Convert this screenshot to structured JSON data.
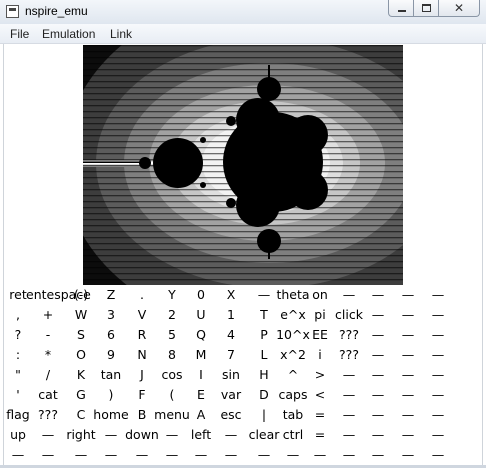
{
  "window": {
    "title": "nspire_emu",
    "close_label": "✕"
  },
  "menu": [
    "File",
    "Emulation",
    "Link"
  ],
  "keypad_rows": [
    [
      "ret",
      "entespace",
      "(-)",
      "Z",
      ".",
      "Y",
      "0",
      "X",
      "—",
      "theta",
      "on",
      "—",
      "—",
      "—",
      "—"
    ],
    [
      ",",
      "+",
      "W",
      "3",
      "V",
      "2",
      "U",
      "1",
      "T",
      "e^x",
      "pi",
      "click",
      "—",
      "—",
      "—"
    ],
    [
      "?",
      "-",
      "S",
      "6",
      "R",
      "5",
      "Q",
      "4",
      "P",
      "10^x",
      "EE",
      "???",
      "—",
      "—",
      "—"
    ],
    [
      ":",
      "*",
      "O",
      "9",
      "N",
      "8",
      "M",
      "7",
      "L",
      "x^2",
      "i",
      "???",
      "—",
      "—",
      "—"
    ],
    [
      "\"",
      "/",
      "K",
      "tan",
      "J",
      "cos",
      "I",
      "sin",
      "H",
      "^",
      ">",
      "—",
      "—",
      "—",
      "—"
    ],
    [
      "'",
      "cat",
      "G",
      ")",
      "F",
      "(",
      "E",
      "var",
      "D",
      "caps",
      "<",
      "—",
      "—",
      "—",
      "—"
    ],
    [
      "flag",
      "???",
      "C",
      "home",
      "B",
      "menu",
      "A",
      "esc",
      "|",
      "tab",
      "=",
      "—",
      "—",
      "—",
      "—"
    ],
    [
      "up",
      "—",
      "right",
      "—",
      "down",
      "—",
      "left",
      "—",
      "clear",
      "ctrl",
      "=",
      "—",
      "—",
      "—",
      "—"
    ],
    [
      "—",
      "—",
      "—",
      "—",
      "—",
      "—",
      "—",
      "—",
      "—",
      "—",
      "—",
      "—",
      "—",
      "—",
      "—"
    ]
  ]
}
